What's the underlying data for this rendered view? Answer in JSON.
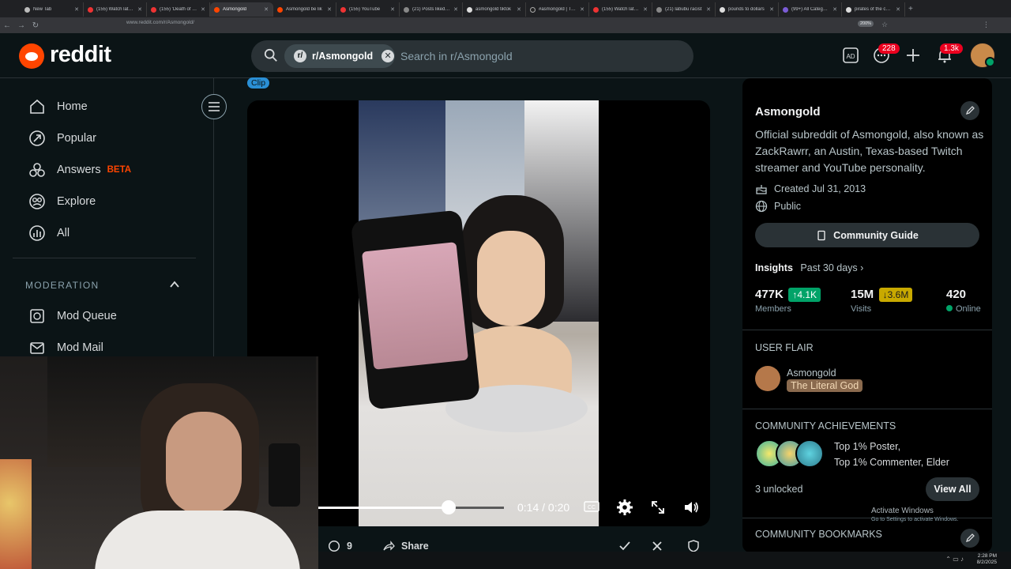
{
  "browser": {
    "tabs": [
      "New Tab",
      "(155) Watch later -",
      "(155) 'Death of a fr",
      "Asmongold",
      "Asmongold be lik",
      "(155) YouTube",
      "(21) Posts liked by",
      "asmongold tiktok",
      "#asmongold | TikTo",
      "(155) Watch later -",
      "(21) labubu racist",
      "pounds to dollars",
      "(99+) All Categorie",
      "pirates of the carib"
    ],
    "active_tab_index": 3,
    "url": "www.reddit.com/r/Asmongold/",
    "zoom": "200%"
  },
  "header": {
    "wordmark": "reddit",
    "search_chip": "r/Asmongold",
    "search_placeholder": "Search in r/Asmongold",
    "chat_badge": "228",
    "notif_badge": "1.3k"
  },
  "sidebar": {
    "items": [
      {
        "label": "Home"
      },
      {
        "label": "Popular"
      },
      {
        "label": "Answers",
        "tag": "BETA"
      },
      {
        "label": "Explore"
      },
      {
        "label": "All"
      }
    ],
    "moderation_header": "MODERATION",
    "mod_items": [
      {
        "label": "Mod Queue"
      },
      {
        "label": "Mod Mail"
      }
    ]
  },
  "post": {
    "flair": "Clip",
    "time_current": "0:14",
    "time_total": "0:20",
    "time_sep": " / ",
    "progress": 0.7,
    "comments": "9",
    "share_label": "Share"
  },
  "community": {
    "name": "Asmongold",
    "description": "Official subreddit of Asmongold, also known as ZackRawrr, an Austin, Texas-based Twitch streamer and YouTube personality.",
    "created": "Created Jul 31, 2013",
    "visibility": "Public",
    "guide_button": "Community Guide",
    "insights_label": "Insights",
    "insights_period": "Past 30 days",
    "members_value": "477K",
    "members_delta": "4.1K",
    "members_label": "Members",
    "visits_value": "15M",
    "visits_delta": "3.6M",
    "visits_label": "Visits",
    "online_value": "420",
    "online_label": "Online",
    "user_flair_header": "USER FLAIR",
    "flair_username": "Asmongold",
    "flair_text": "The Literal God",
    "achievements_header": "COMMUNITY ACHIEVEMENTS",
    "achievements_line1": "Top 1% Poster,",
    "achievements_line2": "Top 1% Commenter, Elder",
    "unlocked": "3 unlocked",
    "view_all": "View All",
    "bookmarks_header": "COMMUNITY BOOKMARKS"
  },
  "os": {
    "activate_title": "Activate Windows",
    "activate_sub": "Go to Settings to activate Windows.",
    "time": "2:28 PM",
    "date": "8/2/2025"
  },
  "colors": {
    "accent": "#ff4500",
    "up_delta": "#01a368",
    "down_delta": "#c8a900",
    "badge": "#eb001f"
  }
}
